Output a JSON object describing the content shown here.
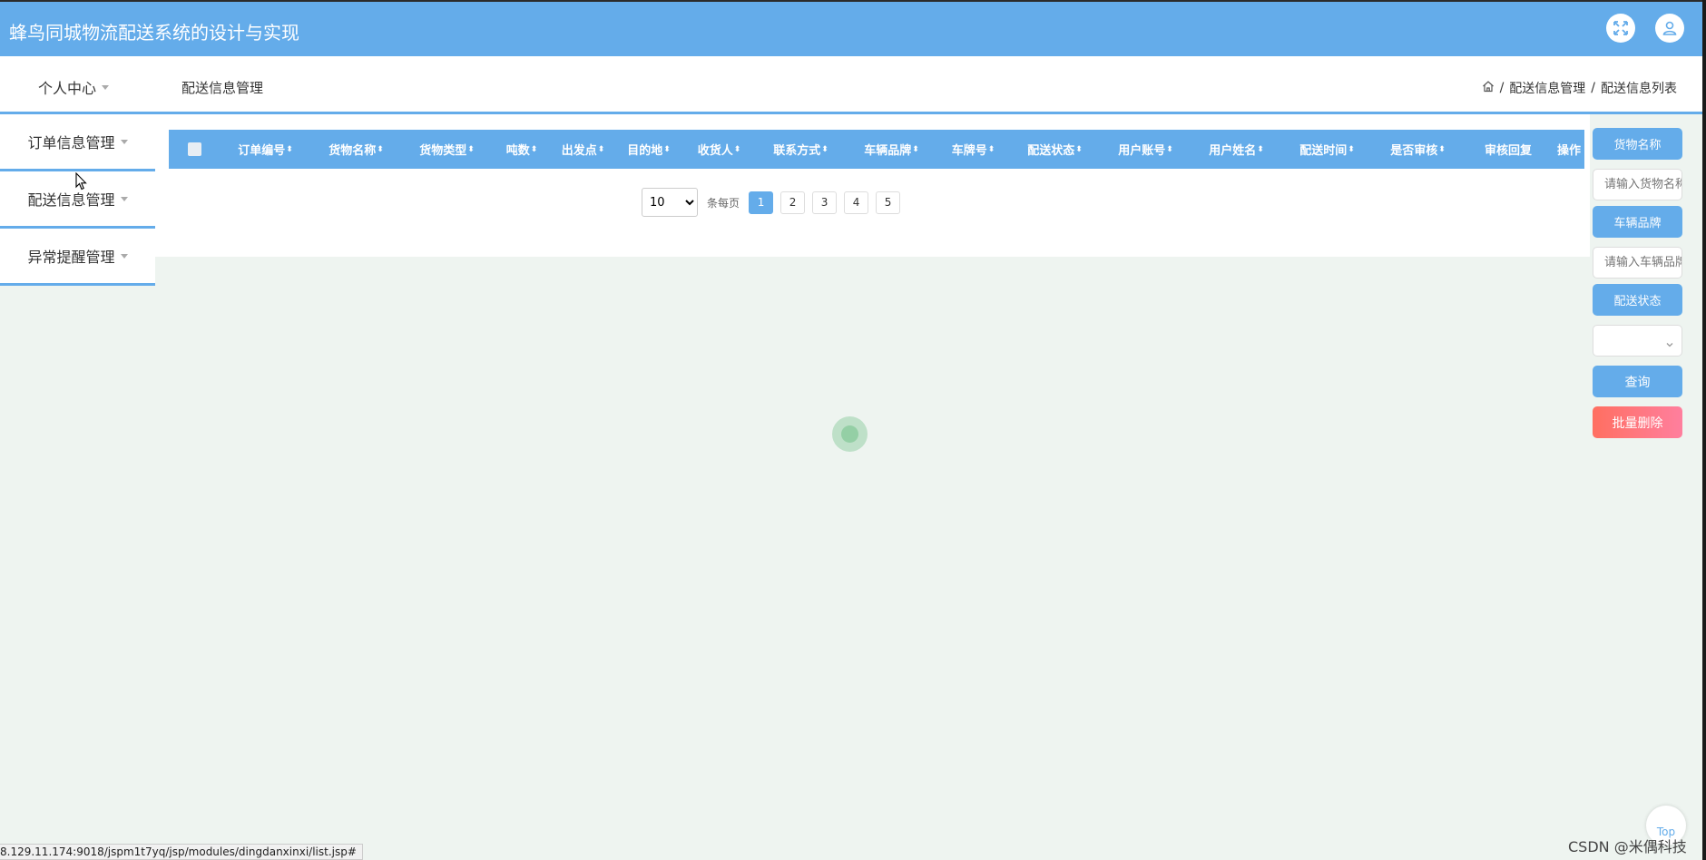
{
  "header": {
    "title": "蜂鸟同城物流配送系统的设计与实现"
  },
  "nav": {
    "personal_center": "个人中心",
    "current_module": "配送信息管理",
    "breadcrumb": [
      "配送信息管理",
      "配送信息列表"
    ],
    "breadcrumb_sep": "/"
  },
  "sidebar": {
    "items": [
      {
        "label": "订单信息管理"
      },
      {
        "label": "配送信息管理"
      },
      {
        "label": "异常提醒管理"
      }
    ]
  },
  "table": {
    "columns": [
      {
        "label": "订单编号",
        "sortable": true
      },
      {
        "label": "货物名称",
        "sortable": true
      },
      {
        "label": "货物类型",
        "sortable": true
      },
      {
        "label": "吨数",
        "sortable": true
      },
      {
        "label": "出发点",
        "sortable": true
      },
      {
        "label": "目的地",
        "sortable": true
      },
      {
        "label": "收货人",
        "sortable": true
      },
      {
        "label": "联系方式",
        "sortable": true
      },
      {
        "label": "车辆品牌",
        "sortable": true
      },
      {
        "label": "车牌号",
        "sortable": true
      },
      {
        "label": "配送状态",
        "sortable": true
      },
      {
        "label": "用户账号",
        "sortable": true
      },
      {
        "label": "用户姓名",
        "sortable": true
      },
      {
        "label": "配送时间",
        "sortable": true
      },
      {
        "label": "是否审核",
        "sortable": true
      },
      {
        "label": "审核回复",
        "sortable": false
      },
      {
        "label": "操作",
        "sortable": false
      }
    ],
    "sort_glyph": "⬍"
  },
  "pagination": {
    "page_size": "10",
    "per_page_label": "条每页",
    "pages": [
      "1",
      "2",
      "3",
      "4",
      "5"
    ],
    "active_page": "1"
  },
  "search": {
    "goods_name_label": "货物名称",
    "goods_name_placeholder": "请输入货物名称",
    "vehicle_brand_label": "车辆品牌",
    "vehicle_brand_placeholder": "请输入车辆品牌",
    "delivery_status_label": "配送状态",
    "query_button": "查询",
    "batch_delete_button": "批量删除"
  },
  "status_bar": {
    "url": "8.129.11.174:9018/jspm1t7yq/jsp/modules/dingdanxinxi/list.jsp#"
  },
  "back_to_top": "Top",
  "watermark": "CSDN @米偶科技",
  "colors": {
    "primary": "#64acea",
    "danger_gradient": [
      "#ff6f61",
      "#ff7f9e"
    ],
    "content_bg": "#eef4f0"
  },
  "icons": {
    "expand": "fullscreen-icon",
    "user": "user-icon",
    "home": "home-icon"
  }
}
